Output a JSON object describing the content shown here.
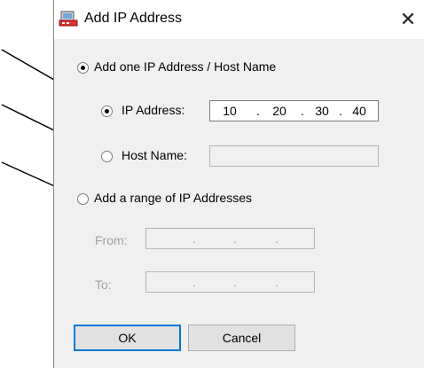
{
  "dialog": {
    "title": "Add IP Address",
    "close_glyph": "✕"
  },
  "options": {
    "add_one": {
      "label": "Add one IP Address / Host Name",
      "selected": true
    },
    "ip_address": {
      "label": "IP Address:",
      "selected": true,
      "octets": [
        "10",
        "20",
        "30",
        "40"
      ]
    },
    "host_name": {
      "label": "Host Name:",
      "selected": false,
      "value": ""
    },
    "add_range": {
      "label": "Add a range of IP Addresses",
      "selected": false
    },
    "from": {
      "label": "From:",
      "octets": [
        "",
        "",
        "",
        ""
      ]
    },
    "to": {
      "label": "To:",
      "octets": [
        "",
        "",
        "",
        ""
      ]
    }
  },
  "separator": ".",
  "buttons": {
    "ok": "OK",
    "cancel": "Cancel"
  },
  "icons": {
    "title_icon": "network-computer-icon",
    "close": "close-icon"
  },
  "colors": {
    "dialog_bg": "#f0f0f0",
    "titlebar_bg": "#ffffff",
    "disabled_text": "#a0a0a0",
    "accent": "#0078d7"
  }
}
